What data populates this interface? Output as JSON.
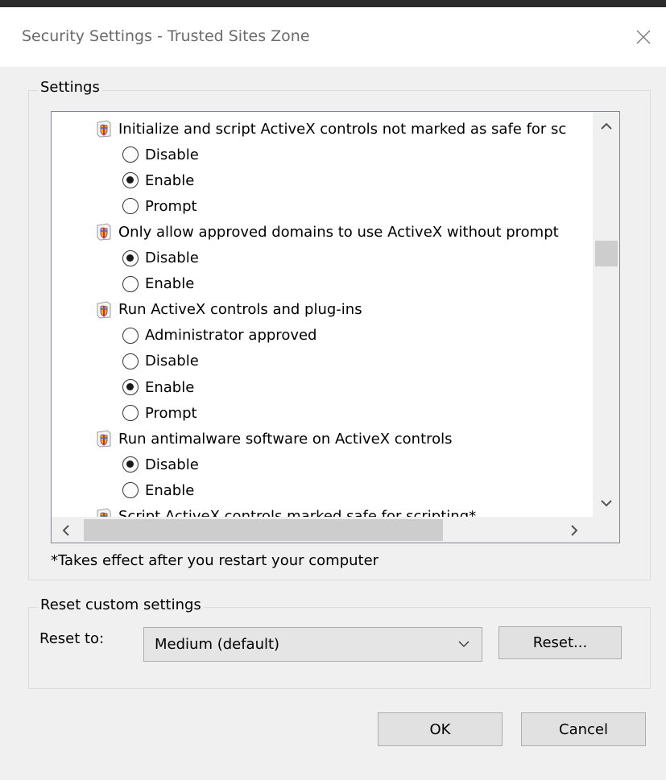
{
  "window": {
    "title": "Security Settings - Trusted Sites Zone",
    "close_glyph": "✕"
  },
  "settings_group": {
    "legend": "Settings",
    "items": [
      {
        "type": "header",
        "label": "Initialize and script ActiveX controls not marked as safe for sc",
        "icon": "security-shield-icon"
      },
      {
        "type": "option",
        "label": "Disable",
        "checked": false
      },
      {
        "type": "option",
        "label": "Enable",
        "checked": true
      },
      {
        "type": "option",
        "label": "Prompt",
        "checked": false
      },
      {
        "type": "header",
        "label": "Only allow approved domains to use ActiveX without prompt",
        "icon": "security-shield-icon"
      },
      {
        "type": "option",
        "label": "Disable",
        "checked": true
      },
      {
        "type": "option",
        "label": "Enable",
        "checked": false
      },
      {
        "type": "header",
        "label": "Run ActiveX controls and plug-ins",
        "icon": "security-shield-icon"
      },
      {
        "type": "option",
        "label": "Administrator approved",
        "checked": false
      },
      {
        "type": "option",
        "label": "Disable",
        "checked": false
      },
      {
        "type": "option",
        "label": "Enable",
        "checked": true
      },
      {
        "type": "option",
        "label": "Prompt",
        "checked": false
      },
      {
        "type": "header",
        "label": "Run antimalware software on ActiveX controls",
        "icon": "security-shield-icon"
      },
      {
        "type": "option",
        "label": "Disable",
        "checked": true
      },
      {
        "type": "option",
        "label": "Enable",
        "checked": false
      },
      {
        "type": "header",
        "label": "Script ActiveX controls marked safe for scripting*",
        "icon": "security-shield-icon"
      }
    ],
    "note": "*Takes effect after you restart your computer"
  },
  "reset_group": {
    "legend": "Reset custom settings",
    "reset_to_label": "Reset to:",
    "selected_level": "Medium (default)",
    "reset_button": "Reset..."
  },
  "buttons": {
    "ok": "OK",
    "cancel": "Cancel"
  },
  "scrollbars": {
    "up": "⌃",
    "down": "⌄",
    "left": "‹",
    "right": "›"
  },
  "colors": {
    "dialog_bg": "#f0f0f0",
    "list_bg": "#ffffff",
    "button_bg": "#e1e1e1",
    "title_text": "#6b6b6b"
  }
}
